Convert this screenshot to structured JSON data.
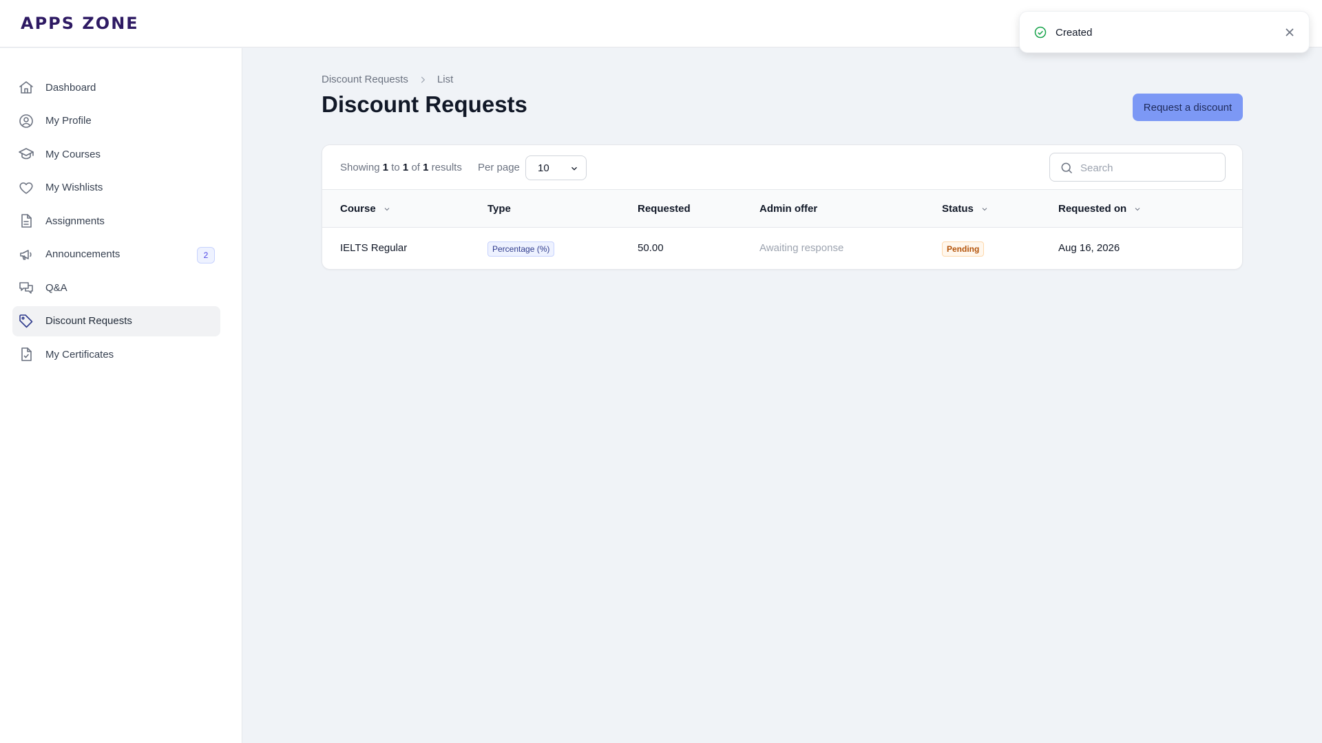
{
  "app": {
    "logo": "APPS ZONE"
  },
  "sidebar": {
    "items": [
      {
        "label": "Dashboard",
        "icon": "home-icon"
      },
      {
        "label": "My Profile",
        "icon": "user-circle-icon"
      },
      {
        "label": "My Courses",
        "icon": "graduation-cap-icon"
      },
      {
        "label": "My Wishlists",
        "icon": "heart-icon"
      },
      {
        "label": "Assignments",
        "icon": "document-icon"
      },
      {
        "label": "Announcements",
        "icon": "megaphone-icon",
        "badge": "2"
      },
      {
        "label": "Q&A",
        "icon": "chat-bubbles-icon"
      },
      {
        "label": "Discount Requests",
        "icon": "tag-icon",
        "active": true
      },
      {
        "label": "My Certificates",
        "icon": "certificate-icon"
      }
    ]
  },
  "breadcrumb": {
    "root": "Discount Requests",
    "current": "List"
  },
  "page": {
    "title": "Discount Requests",
    "action_label": "Request a discount"
  },
  "table": {
    "showing": {
      "prefix": "Showing",
      "from": "1",
      "to_word": "to",
      "to": "1",
      "of_word": "of",
      "total": "1",
      "suffix": "results"
    },
    "per_page_label": "Per page",
    "per_page_value": "10",
    "search_placeholder": "Search",
    "columns": {
      "course": "Course",
      "type": "Type",
      "requested": "Requested",
      "admin_offer": "Admin offer",
      "status": "Status",
      "requested_on": "Requested on"
    },
    "rows": [
      {
        "course": "IELTS Regular",
        "type": "Percentage (%)",
        "requested": "50.00",
        "admin_offer": "Awaiting response",
        "status": "Pending",
        "requested_on": "Aug 16, 2026"
      }
    ]
  },
  "toast": {
    "message": "Created"
  },
  "colors": {
    "accent": "#7c98f5",
    "brand": "#2e1a63",
    "status_pending": "#b45309",
    "success": "#16a34a"
  }
}
